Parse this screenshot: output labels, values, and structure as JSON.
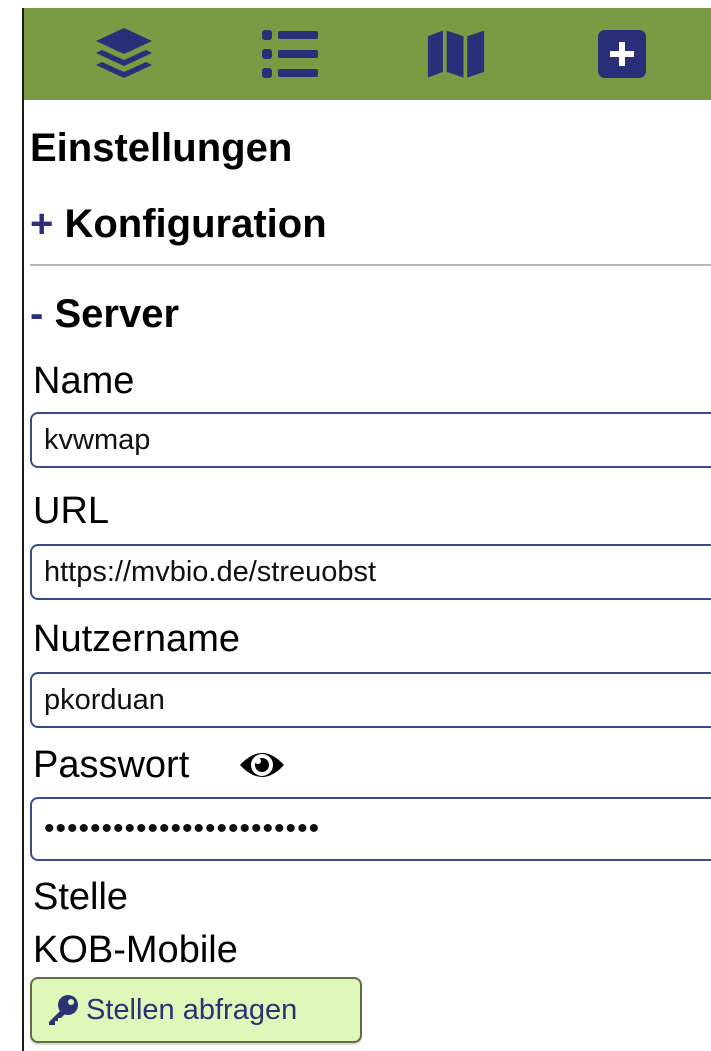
{
  "toolbar": {
    "buttons": [
      {
        "name": "layers",
        "icon": "layers-icon"
      },
      {
        "name": "list",
        "icon": "list-icon"
      },
      {
        "name": "map",
        "icon": "map-icon"
      },
      {
        "name": "add",
        "icon": "plus-square-icon"
      }
    ],
    "background": "#7a9a43",
    "icon_color": "#2b2f7a"
  },
  "page": {
    "title": "Einstellungen"
  },
  "sections": {
    "konfiguration": {
      "toggle": "+",
      "label": "Konfiguration"
    },
    "server": {
      "toggle": "-",
      "label": "Server"
    }
  },
  "server": {
    "name_label": "Name",
    "name_value": "kvwmap",
    "url_label": "URL",
    "url_value": "https://mvbio.de/streuobst",
    "username_label": "Nutzername",
    "username_value": "pkorduan",
    "password_label": "Passwort",
    "password_mask": "••••••••••••••••••••••••",
    "password_toggle_icon": "eye-icon",
    "stelle_label": "Stelle",
    "stelle_value": "KOB-Mobile",
    "query_button_label": "Stellen abfragen",
    "query_button_icon": "key-icon"
  }
}
